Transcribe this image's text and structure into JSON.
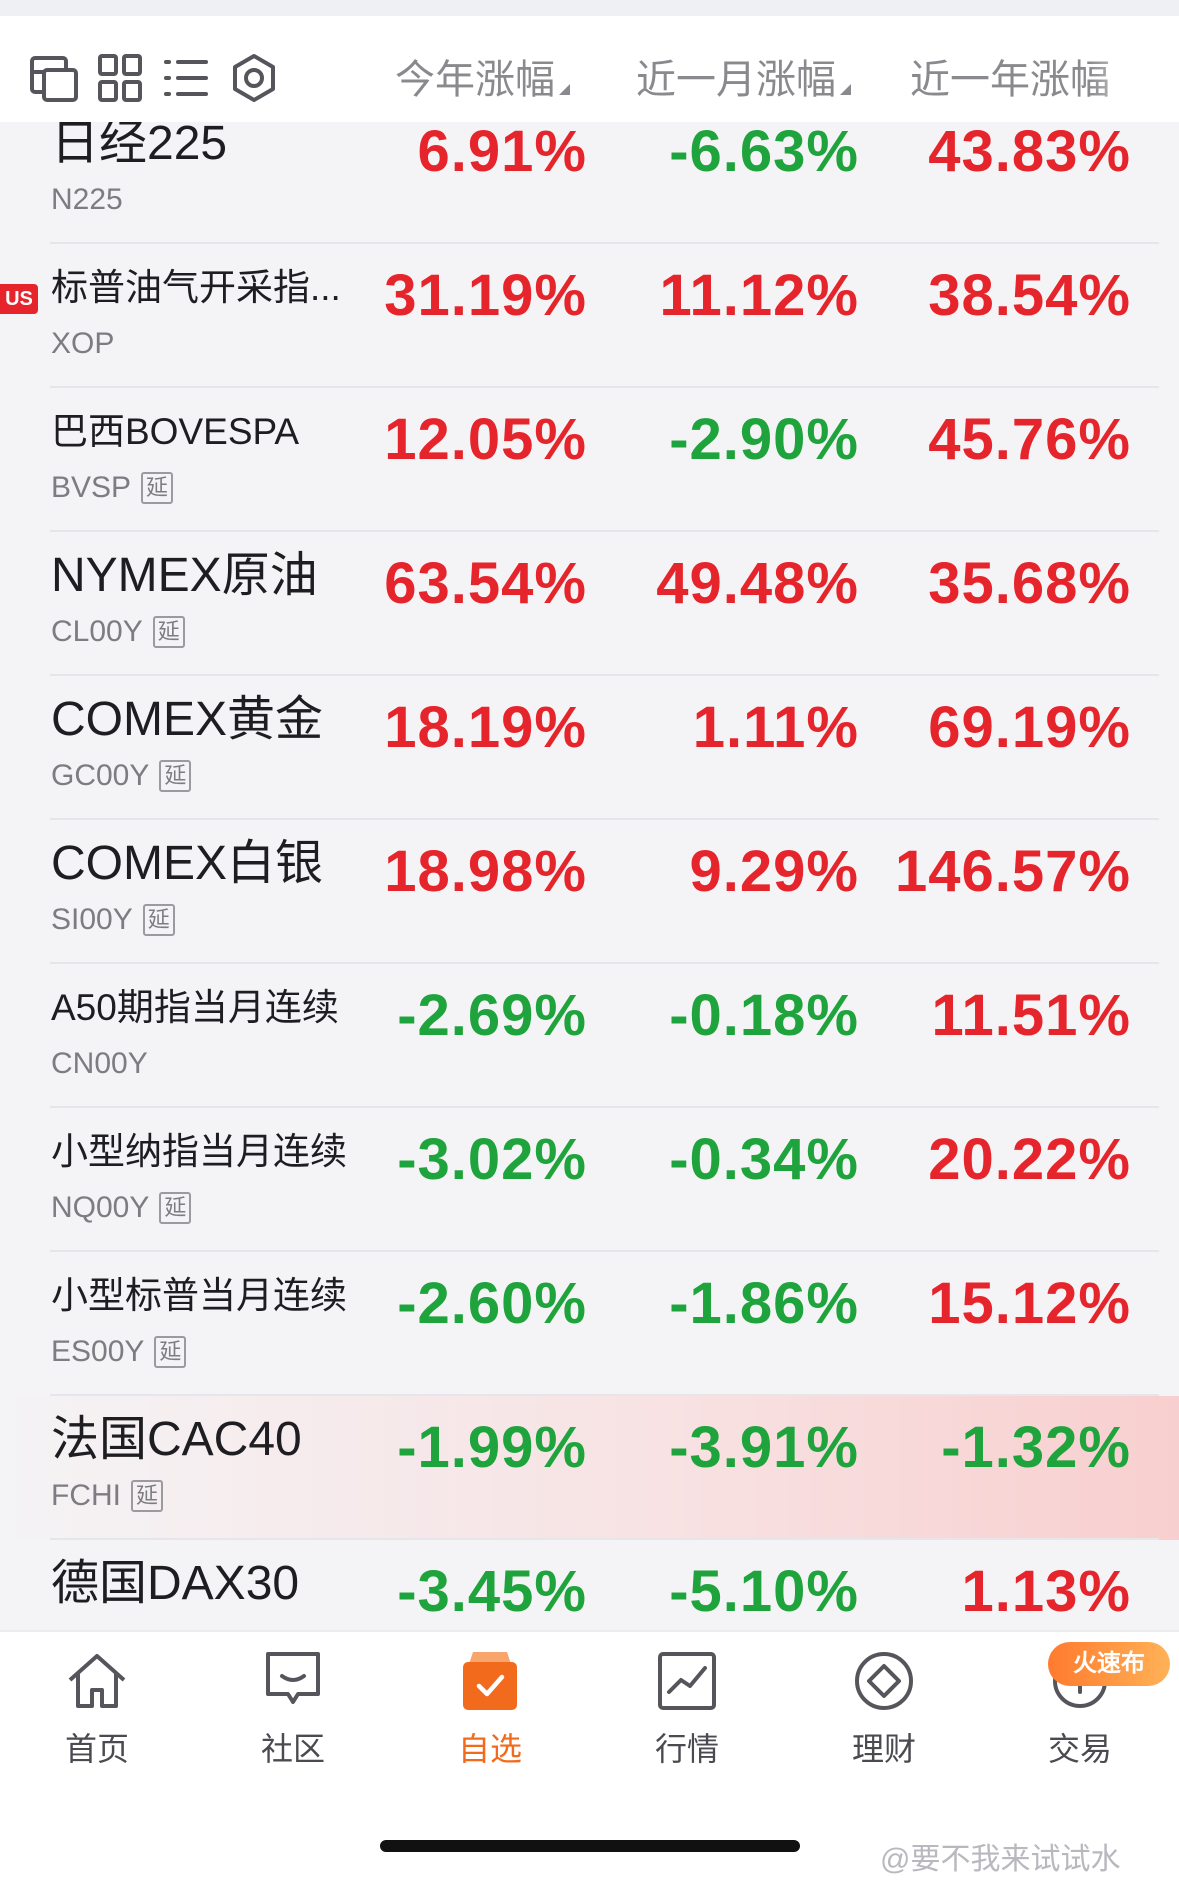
{
  "header": {
    "icons": [
      "switch-view-icon",
      "grid-icon",
      "list-icon",
      "settings-ring-icon"
    ],
    "columns": [
      "今年涨幅",
      "近一月涨幅",
      "近一年涨幅"
    ]
  },
  "colors": {
    "up": "#e5242c",
    "down": "#1fa33c",
    "accent": "#f26a1b"
  },
  "rows": [
    {
      "name": "日经225",
      "code": "N225",
      "badge": "",
      "yan": false,
      "ytd": "6.91%",
      "m1": "-6.63%",
      "y1": "43.83%"
    },
    {
      "name": "标普油气开采指...",
      "code": "XOP",
      "badge": "US",
      "yan": false,
      "ytd": "31.19%",
      "m1": "11.12%",
      "y1": "38.54%"
    },
    {
      "name": "巴西BOVESPA",
      "code": "BVSP",
      "badge": "",
      "yan": true,
      "ytd": "12.05%",
      "m1": "-2.90%",
      "y1": "45.76%"
    },
    {
      "name": "NYMEX原油",
      "code": "CL00Y",
      "badge": "",
      "yan": true,
      "ytd": "63.54%",
      "m1": "49.48%",
      "y1": "35.68%"
    },
    {
      "name": "COMEX黄金",
      "code": "GC00Y",
      "badge": "",
      "yan": true,
      "ytd": "18.19%",
      "m1": "1.11%",
      "y1": "69.19%"
    },
    {
      "name": "COMEX白银",
      "code": "SI00Y",
      "badge": "",
      "yan": true,
      "ytd": "18.98%",
      "m1": "9.29%",
      "y1": "146.57%"
    },
    {
      "name": "A50期指当月连续",
      "code": "CN00Y",
      "badge": "",
      "yan": false,
      "ytd": "-2.69%",
      "m1": "-0.18%",
      "y1": "11.51%"
    },
    {
      "name": "小型纳指当月连续",
      "code": "NQ00Y",
      "badge": "",
      "yan": true,
      "ytd": "-3.02%",
      "m1": "-0.34%",
      "y1": "20.22%"
    },
    {
      "name": "小型标普当月连续",
      "code": "ES00Y",
      "badge": "",
      "yan": true,
      "ytd": "-2.60%",
      "m1": "-1.86%",
      "y1": "15.12%"
    },
    {
      "name": "法国CAC40",
      "code": "FCHI",
      "badge": "",
      "yan": true,
      "ytd": "-1.99%",
      "m1": "-3.91%",
      "y1": "-1.32%"
    },
    {
      "name": "德国DAX30",
      "code": "",
      "badge": "",
      "yan": false,
      "ytd": "-3.45%",
      "m1": "-5.10%",
      "y1": "1.13%"
    }
  ],
  "delay_tag": "延",
  "tabs": [
    {
      "label": "首页",
      "icon": "home-icon"
    },
    {
      "label": "社区",
      "icon": "chat-icon"
    },
    {
      "label": "自选",
      "icon": "watchlist-icon"
    },
    {
      "label": "行情",
      "icon": "market-chart-icon"
    },
    {
      "label": "理财",
      "icon": "finance-icon"
    },
    {
      "label": "交易",
      "icon": "trade-icon"
    }
  ],
  "promo_badge": "火速布",
  "watermark": "@要不我来试试水"
}
